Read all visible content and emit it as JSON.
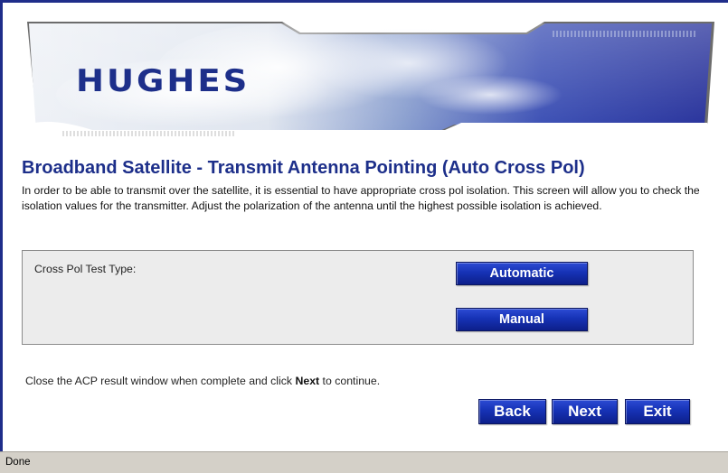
{
  "banner": {
    "logo_text": "HUGHES",
    "logo_tm": "™"
  },
  "page": {
    "title": "Broadband Satellite - Transmit Antenna Pointing (Auto Cross Pol)",
    "intro": "In order to be able to transmit over the satellite, it is essential to have appropriate cross pol isolation. This screen will allow you to check the isolation values for the transmitter. Adjust the polarization of the antenna until the highest possible isolation is achieved."
  },
  "cross_pol": {
    "label": "Cross Pol Test Type:",
    "automatic_label": "Automatic",
    "manual_label": "Manual"
  },
  "instructions": {
    "before": "Close the ACP result window when complete and click ",
    "bold": "Next",
    "after": " to continue."
  },
  "nav": {
    "back_label": "Back",
    "next_label": "Next",
    "exit_label": "Exit"
  },
  "status": {
    "text": "Done"
  },
  "colors": {
    "brand_blue": "#1d2f8a",
    "button_blue": "#1632b5",
    "panel_bg": "#ececec",
    "statusbar_bg": "#d4d0c8"
  }
}
